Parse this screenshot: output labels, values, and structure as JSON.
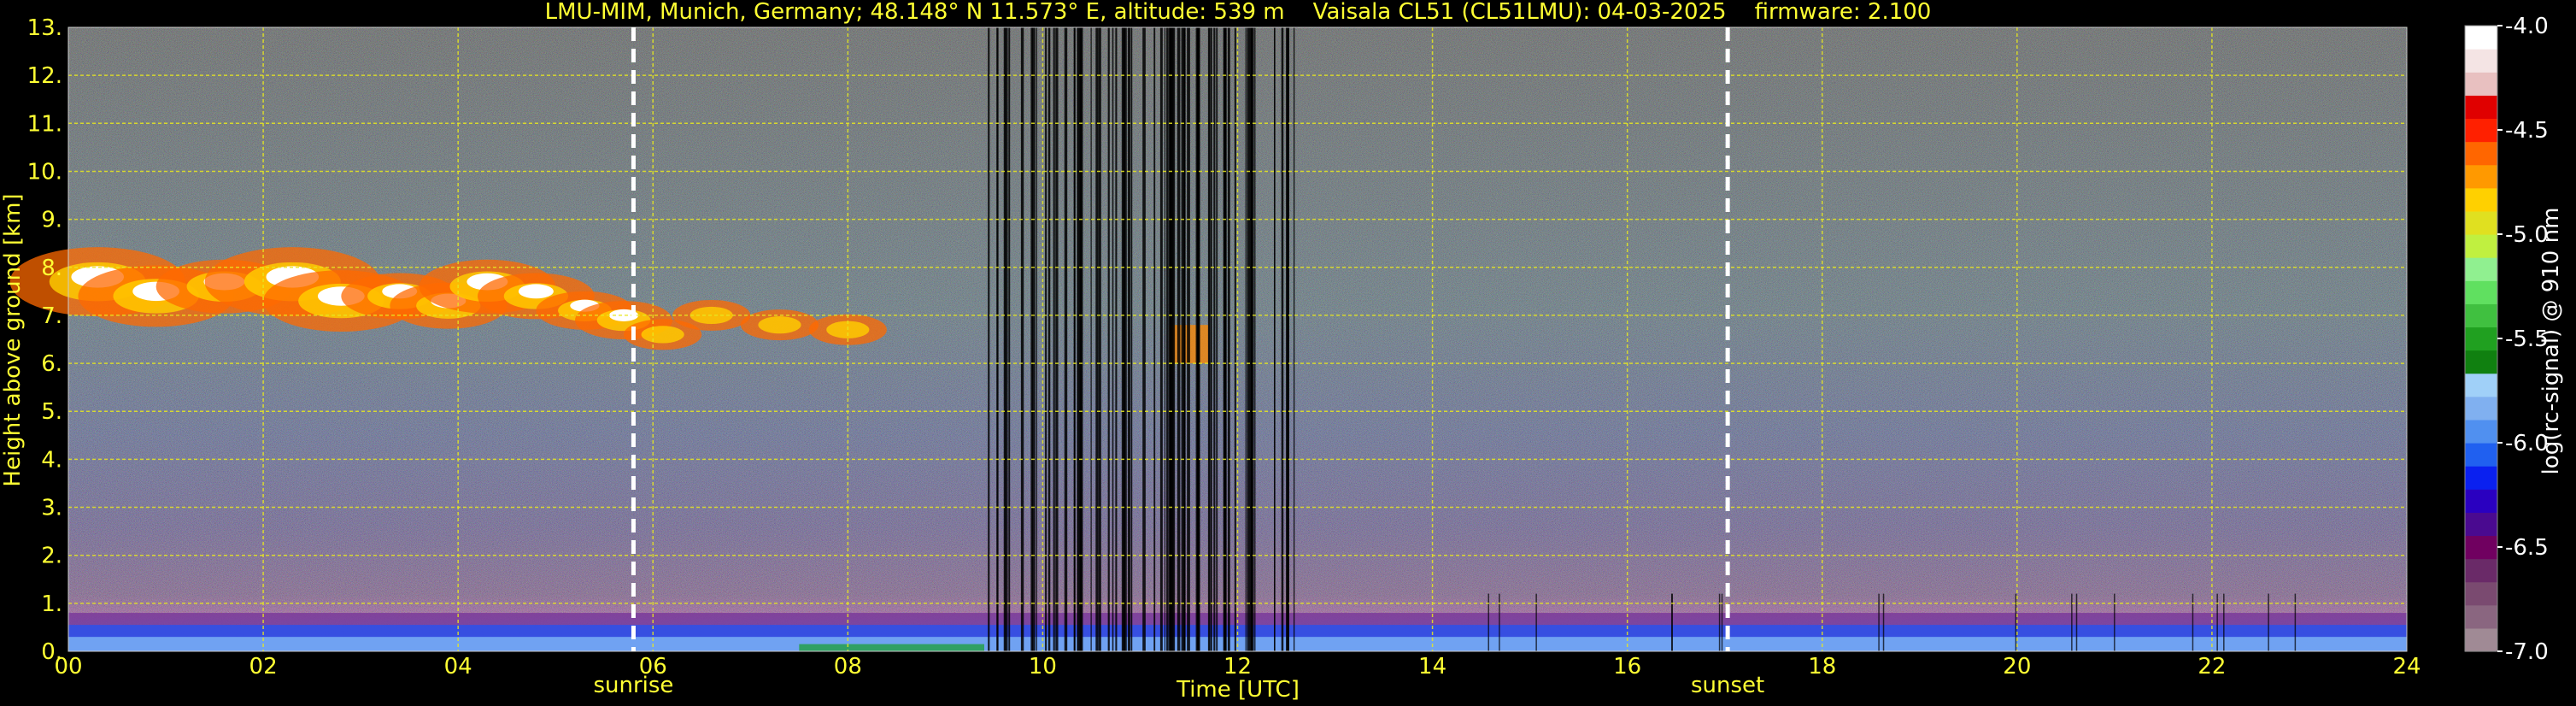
{
  "chart_data": {
    "type": "heatmap",
    "title": "LMU-MIM, Munich, Germany; 48.148° N 11.573° E, altitude: 539 m    Vaisala CL51 (CL51LMU): 04-03-2025    firmware: 2.100",
    "xlabel": "Time [UTC]",
    "ylabel": "Height above ground [km]",
    "xlim": [
      0,
      24
    ],
    "ylim": [
      0,
      13
    ],
    "x_ticks": [
      "00",
      "02",
      "04",
      "06",
      "08",
      "10",
      "12",
      "14",
      "16",
      "18",
      "20",
      "22",
      "24"
    ],
    "x_tick_values": [
      0,
      2,
      4,
      6,
      8,
      10,
      12,
      14,
      16,
      18,
      20,
      22,
      24
    ],
    "y_ticks": [
      "0.",
      "1.",
      "2.",
      "3.",
      "4.",
      "5.",
      "6.",
      "7.",
      "8.",
      "9.",
      "10.",
      "11.",
      "12.",
      "13."
    ],
    "y_tick_values": [
      0,
      1,
      2,
      3,
      4,
      5,
      6,
      7,
      8,
      9,
      10,
      11,
      12,
      13
    ],
    "grid": true,
    "markers": [
      {
        "label": "sunrise",
        "time": 5.8
      },
      {
        "label": "sunset",
        "time": 17.03
      }
    ],
    "colorbar": {
      "label": "log(rc-signal) @ 910 nm",
      "ticks": [
        "-4.0",
        "-4.5",
        "-5.0",
        "-5.5",
        "-6.0",
        "-6.5",
        "-7.0"
      ],
      "tick_values": [
        -4.0,
        -4.5,
        -5.0,
        -5.5,
        -6.0,
        -6.5,
        -7.0
      ],
      "range": [
        -7.0,
        -4.0
      ],
      "colors": [
        "#a08a95",
        "#8a6680",
        "#7a4a70",
        "#6a2a68",
        "#700060",
        "#4a0a90",
        "#2a00c0",
        "#0a20f0",
        "#2060f0",
        "#5090f0",
        "#80b0f0",
        "#a0d0f8",
        "#108010",
        "#20a020",
        "#40c040",
        "#60e060",
        "#90f090",
        "#c0f040",
        "#e0e020",
        "#ffd000",
        "#ff9900",
        "#ff6600",
        "#ff2000",
        "#e00000",
        "#e8c0c0",
        "#f4e4e4",
        "#ffffff"
      ]
    },
    "features": {
      "cloud_layer": {
        "start_time": 0,
        "end_time": 9.0,
        "base_km": 6.2,
        "top_km": 8.8,
        "peak_log_signal": -4.0
      },
      "mid_cloud": {
        "start_time": 11.3,
        "end_time": 11.7,
        "base_km": 6.0,
        "top_km": 6.8
      },
      "boundary_layer_top_km": 0.8,
      "instrument_gaps_time_range": [
        9.4,
        12.6
      ]
    }
  }
}
